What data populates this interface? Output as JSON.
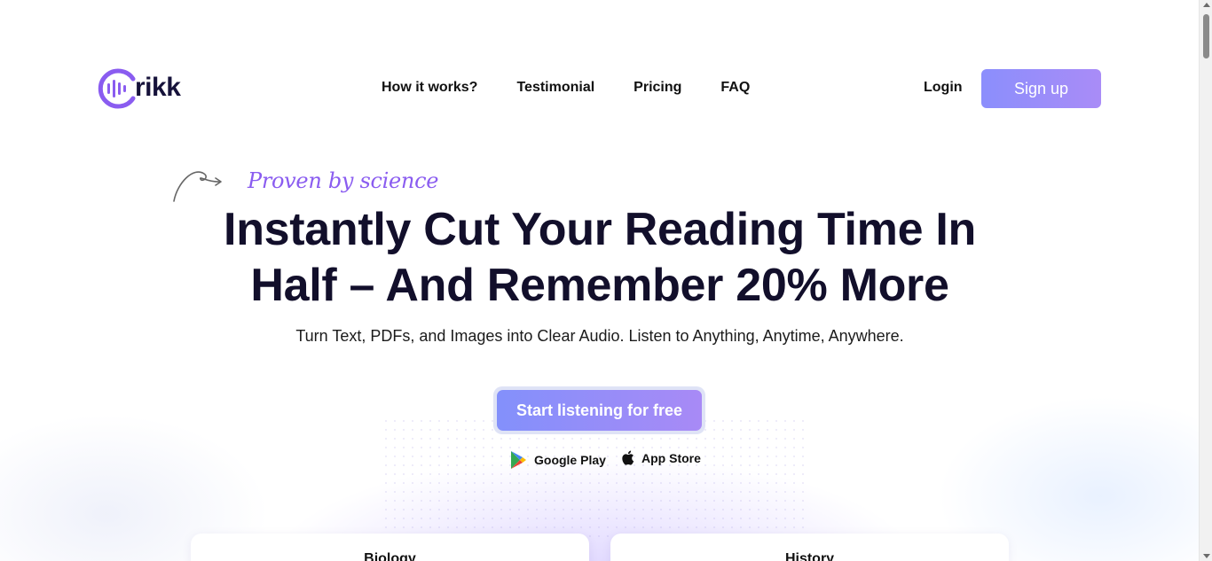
{
  "brand": {
    "name": "rikk",
    "color": "#8a5cf0"
  },
  "nav": {
    "items": [
      {
        "label": "How it works?"
      },
      {
        "label": "Testimonial"
      },
      {
        "label": "Pricing"
      },
      {
        "label": "FAQ"
      }
    ],
    "login_label": "Login",
    "signup_label": "Sign up"
  },
  "hero": {
    "tagline": "Proven by science",
    "headline": "Instantly Cut Your Reading Time In Half – And Remember 20% More",
    "subheadline": "Turn Text, PDFs, and Images into Clear Audio. Listen to Anything, Anytime, Anywhere.",
    "cta_label": "Start listening for free",
    "stores": {
      "google_play": "Google Play",
      "app_store": "App Store"
    }
  },
  "cards": [
    {
      "title": "Biology"
    },
    {
      "title": "History"
    }
  ],
  "colors": {
    "accent_start": "#8390fb",
    "accent_end": "#a88af6",
    "text_dark": "#120f2b"
  }
}
